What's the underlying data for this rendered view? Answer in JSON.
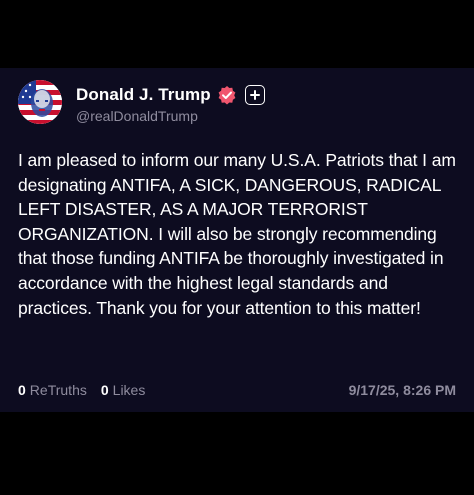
{
  "post": {
    "author": {
      "display_name": "Donald J. Trump",
      "handle": "@realDonaldTrump",
      "verified_badge_icon": "verified-badge-icon",
      "verified_badge_color": "#f0566e",
      "follow_icon": "plus-icon"
    },
    "text": "I am pleased to inform our many U.S.A. Patriots that I am designating ANTIFA, A SICK, DANGEROUS, RADICAL LEFT DISASTER, AS A MAJOR TERRORIST ORGANIZATION. I will also be strongly recommending that those funding ANTIFA be thoroughly investigated in accordance with the highest legal standards and practices. Thank you for your attention to this matter!",
    "stats": {
      "retruths_count": "0",
      "retruths_label": "ReTruths",
      "likes_count": "0",
      "likes_label": "Likes"
    },
    "timestamp": "9/17/25, 8:26 PM"
  },
  "colors": {
    "page_background": "#000000",
    "card_background": "#0d0c20",
    "primary_text": "#ffffff",
    "secondary_text": "#8f8c9e"
  }
}
